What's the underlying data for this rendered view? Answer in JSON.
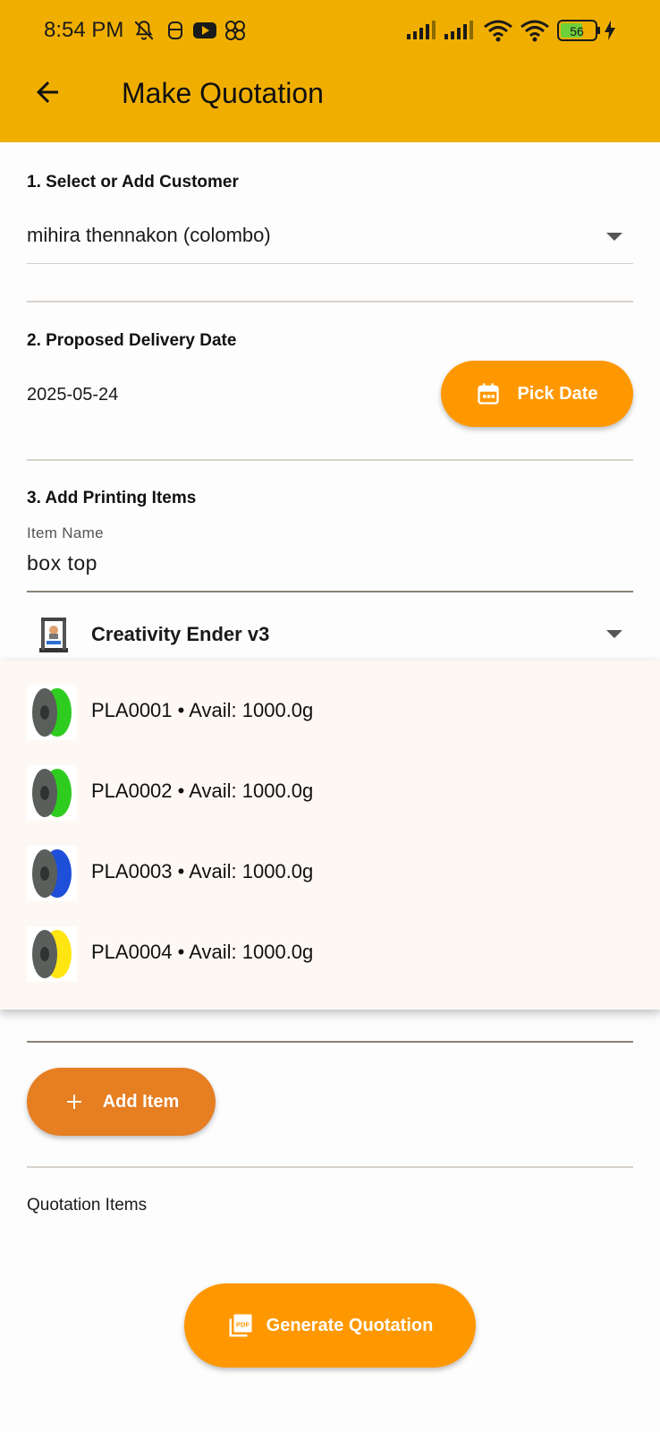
{
  "status_bar": {
    "time": "8:54 PM",
    "battery": "56",
    "icons": [
      "bell-off-icon",
      "gamepad-icon",
      "youtube-icon",
      "link-icon",
      "signal-icon",
      "signal-icon",
      "wifi-icon",
      "wifi-icon",
      "battery-icon",
      "charging-icon"
    ]
  },
  "app_bar": {
    "title": "Make Quotation",
    "back_icon": "arrow-left-icon"
  },
  "customer_section": {
    "label": "1. Select or Add Customer",
    "selected": "mihira thennakon (colombo)"
  },
  "delivery_section": {
    "label": "2. Proposed Delivery Date",
    "date": "2025-05-24",
    "pick_button": "Pick Date",
    "pick_icon": "calendar-icon"
  },
  "items_section": {
    "label": "3. Add Printing Items",
    "item_name_label": "Item Name",
    "item_name_value": "box top",
    "printer": "Creativity Ender v3",
    "material_options": [
      {
        "label": "PLA0001 • Avail: 1000.0g",
        "color": "#2ecc1f"
      },
      {
        "label": "PLA0002 • Avail: 1000.0g",
        "color": "#2ecc1f"
      },
      {
        "label": "PLA0003 • Avail: 1000.0g",
        "color": "#1e4fd8"
      },
      {
        "label": "PLA0004 • Avail: 1000.0g",
        "color": "#ffe512"
      }
    ],
    "add_button": "Add Item"
  },
  "quotation_items_label": "Quotation Items",
  "generate_button": "Generate Quotation",
  "colors": {
    "app_bar": "#f0af00",
    "primary_button": "#ff9800",
    "add_button": "#e67e22",
    "menu_bg": "#fdf8f3"
  }
}
